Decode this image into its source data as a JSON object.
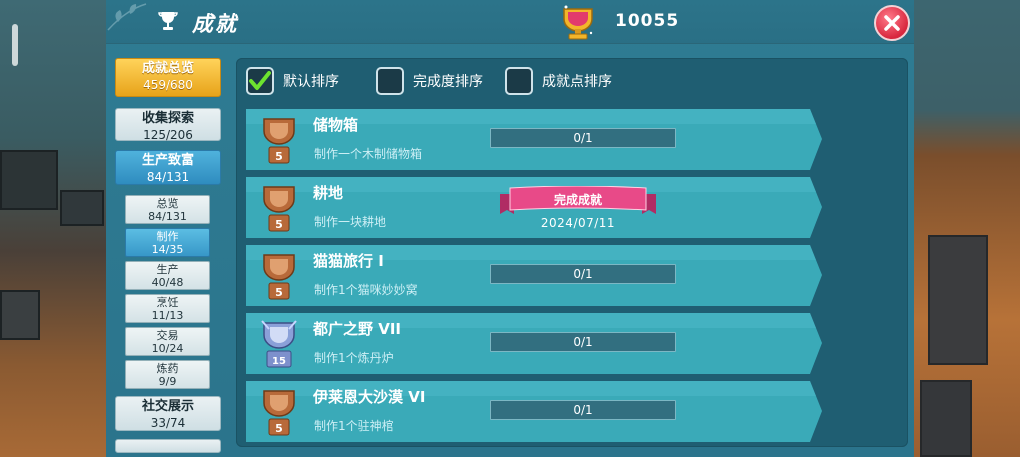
{
  "header": {
    "title": "成就",
    "score": "10055"
  },
  "sidebar": {
    "main_buttons": [
      {
        "label": "成就总览",
        "count": "459/680",
        "style": "gold"
      },
      {
        "label": "收集探索",
        "count": "125/206",
        "style": "white"
      },
      {
        "label": "生产致富",
        "count": "84/131",
        "style": "blue"
      },
      {
        "label": "社交展示",
        "count": "33/74",
        "style": "white"
      }
    ],
    "sub_buttons": [
      {
        "label": "总览",
        "count": "84/131",
        "active": false
      },
      {
        "label": "制作",
        "count": "14/35",
        "active": true
      },
      {
        "label": "生产",
        "count": "40/48",
        "active": false
      },
      {
        "label": "烹饪",
        "count": "11/13",
        "active": false
      },
      {
        "label": "交易",
        "count": "10/24",
        "active": false
      },
      {
        "label": "炼药",
        "count": "9/9",
        "active": false
      }
    ]
  },
  "sort": {
    "options": [
      {
        "label": "默认排序",
        "checked": true
      },
      {
        "label": "完成度排序",
        "checked": false
      },
      {
        "label": "成就点排序",
        "checked": false
      }
    ]
  },
  "achievements": [
    {
      "name": "储物箱",
      "desc": "制作一个木制储物箱",
      "points": "5",
      "medal": "bronze",
      "progress": "0/1",
      "fraction": 0,
      "completed": false
    },
    {
      "name": "耕地",
      "desc": "制作一块耕地",
      "points": "5",
      "medal": "bronze",
      "completed": true,
      "completed_label": "完成成就",
      "completed_date": "2024/07/11"
    },
    {
      "name": "猫猫旅行 I",
      "desc": "制作1个猫咪妙妙窝",
      "points": "5",
      "medal": "bronze",
      "progress": "0/1",
      "fraction": 0,
      "completed": false
    },
    {
      "name": "都广之野 VII",
      "desc": "制作1个炼丹炉",
      "points": "15",
      "medal": "silver",
      "progress": "0/1",
      "fraction": 0,
      "completed": false
    },
    {
      "name": "伊莱恩大沙漠 VI",
      "desc": "制作1个驻神棺",
      "points": "5",
      "medal": "bronze",
      "progress": "0/1",
      "fraction": 0,
      "completed": false
    }
  ],
  "colors": {
    "bronze": "#b86a3a",
    "silver": "#8aa0d8",
    "pink_ribbon": "#e84a88"
  }
}
